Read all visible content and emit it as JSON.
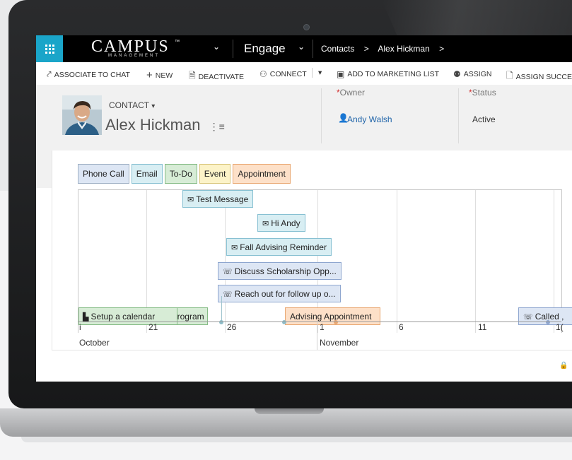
{
  "colors": {
    "nav_bg": "#000000",
    "waffle_bg": "#1aa5c9",
    "header_bg": "#f1f1f1",
    "link": "#2266aa",
    "required": "#d32f2f",
    "message": "#d8eef3",
    "phone_call": "#dde6f4",
    "email": "#d8eef3",
    "todo": "#d7ecd6",
    "event": "#fcf3c8",
    "appointment": "#fde0c8"
  },
  "nav": {
    "waffle_icon": "app-grid-icon",
    "brand_name": "CAMPUS",
    "brand_tm": "™",
    "brand_sub": "MANAGEMENT",
    "brand_chevron": "⌄",
    "module": "Engage",
    "module_chevron": "⌄",
    "breadcrumbs": [
      "Contacts",
      ">",
      "Alex Hickman",
      ">"
    ]
  },
  "commands": {
    "associate": "ASSOCIATE TO CHAT",
    "new": "NEW",
    "deactivate": "DEACTIVATE",
    "connect": "CONNECT",
    "more": "▾",
    "add_to_list": "ADD TO MARKETING LIST",
    "assign": "ASSIGN",
    "assign_success": "ASSIGN SUCCE"
  },
  "record": {
    "form_type": "CONTACT",
    "form_type_chevron": "▾",
    "name": "Alex Hickman",
    "owner_label": "Owner",
    "owner_value": "Andy Walsh",
    "status_label": "Status",
    "status_value": "Active",
    "required_mark": "*"
  },
  "timeline": {
    "legend": [
      {
        "label": "Phone Call",
        "color": "#dde6f4"
      },
      {
        "label": "Email",
        "color": "#d8eef3"
      },
      {
        "label": "To-Do",
        "color": "#d7ecd6"
      },
      {
        "label": "Event",
        "color": "#fcf3c8"
      },
      {
        "label": "Appointment",
        "color": "#fde0c8"
      }
    ],
    "ticks": [
      "i",
      "21",
      "26",
      "1",
      "6",
      "11",
      "1("
    ],
    "months": [
      "October",
      "November"
    ],
    "items": [
      {
        "label": "Test Message",
        "type": "message",
        "icon": "message-icon"
      },
      {
        "label": "Hi Andy",
        "type": "message",
        "icon": "message-icon"
      },
      {
        "label": "Fall Advising Reminder",
        "type": "message",
        "icon": "message-icon"
      },
      {
        "label": "Discuss Scholarship Opp...",
        "type": "call",
        "icon": "phone-icon"
      },
      {
        "label": "Reach out for follow up o...",
        "type": "call",
        "icon": "phone-icon"
      },
      {
        "label": "Setup a calendar",
        "type": "todo",
        "icon": "task-icon"
      },
      {
        "label": "'s rogram",
        "type": "todo",
        "icon": ""
      },
      {
        "label": "Advising Appointment",
        "type": "appointment",
        "icon": ""
      },
      {
        "label": "Called ,",
        "type": "call",
        "icon": "phone-icon"
      }
    ]
  }
}
